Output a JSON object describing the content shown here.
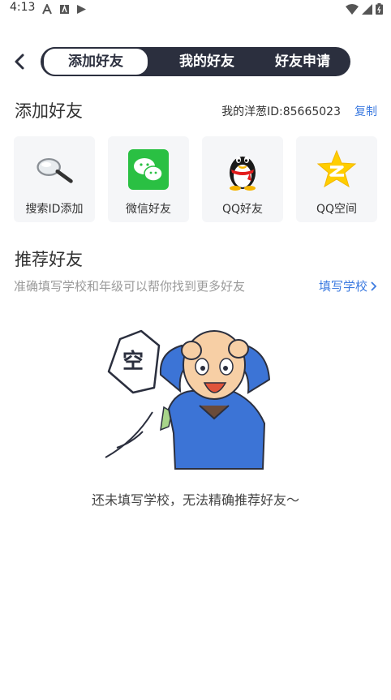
{
  "status_bar": {
    "time": "4:13"
  },
  "tabs": [
    {
      "label": "添加好友",
      "active": true
    },
    {
      "label": "我的好友",
      "active": false
    },
    {
      "label": "好友申请",
      "active": false
    }
  ],
  "add_section": {
    "title": "添加好友",
    "my_id_label": "我的洋葱ID:85665023",
    "copy_label": "复制",
    "options": [
      {
        "label": "搜索ID添加",
        "icon": "magnifier-icon"
      },
      {
        "label": "微信好友",
        "icon": "wechat-icon"
      },
      {
        "label": "QQ好友",
        "icon": "qq-icon"
      },
      {
        "label": "QQ空间",
        "icon": "qzone-icon"
      }
    ]
  },
  "recommend_section": {
    "title": "推荐好友",
    "hint": "准确填写学校和年级可以帮你找到更多好友",
    "fill_school_label": "填写学校",
    "empty_sign_text": "空",
    "empty_text": "还未填写学校，无法精确推荐好友～"
  },
  "colors": {
    "accent": "#3d7be0",
    "tab_bg": "#2b2f3e",
    "card_bg": "#f5f6f8"
  }
}
